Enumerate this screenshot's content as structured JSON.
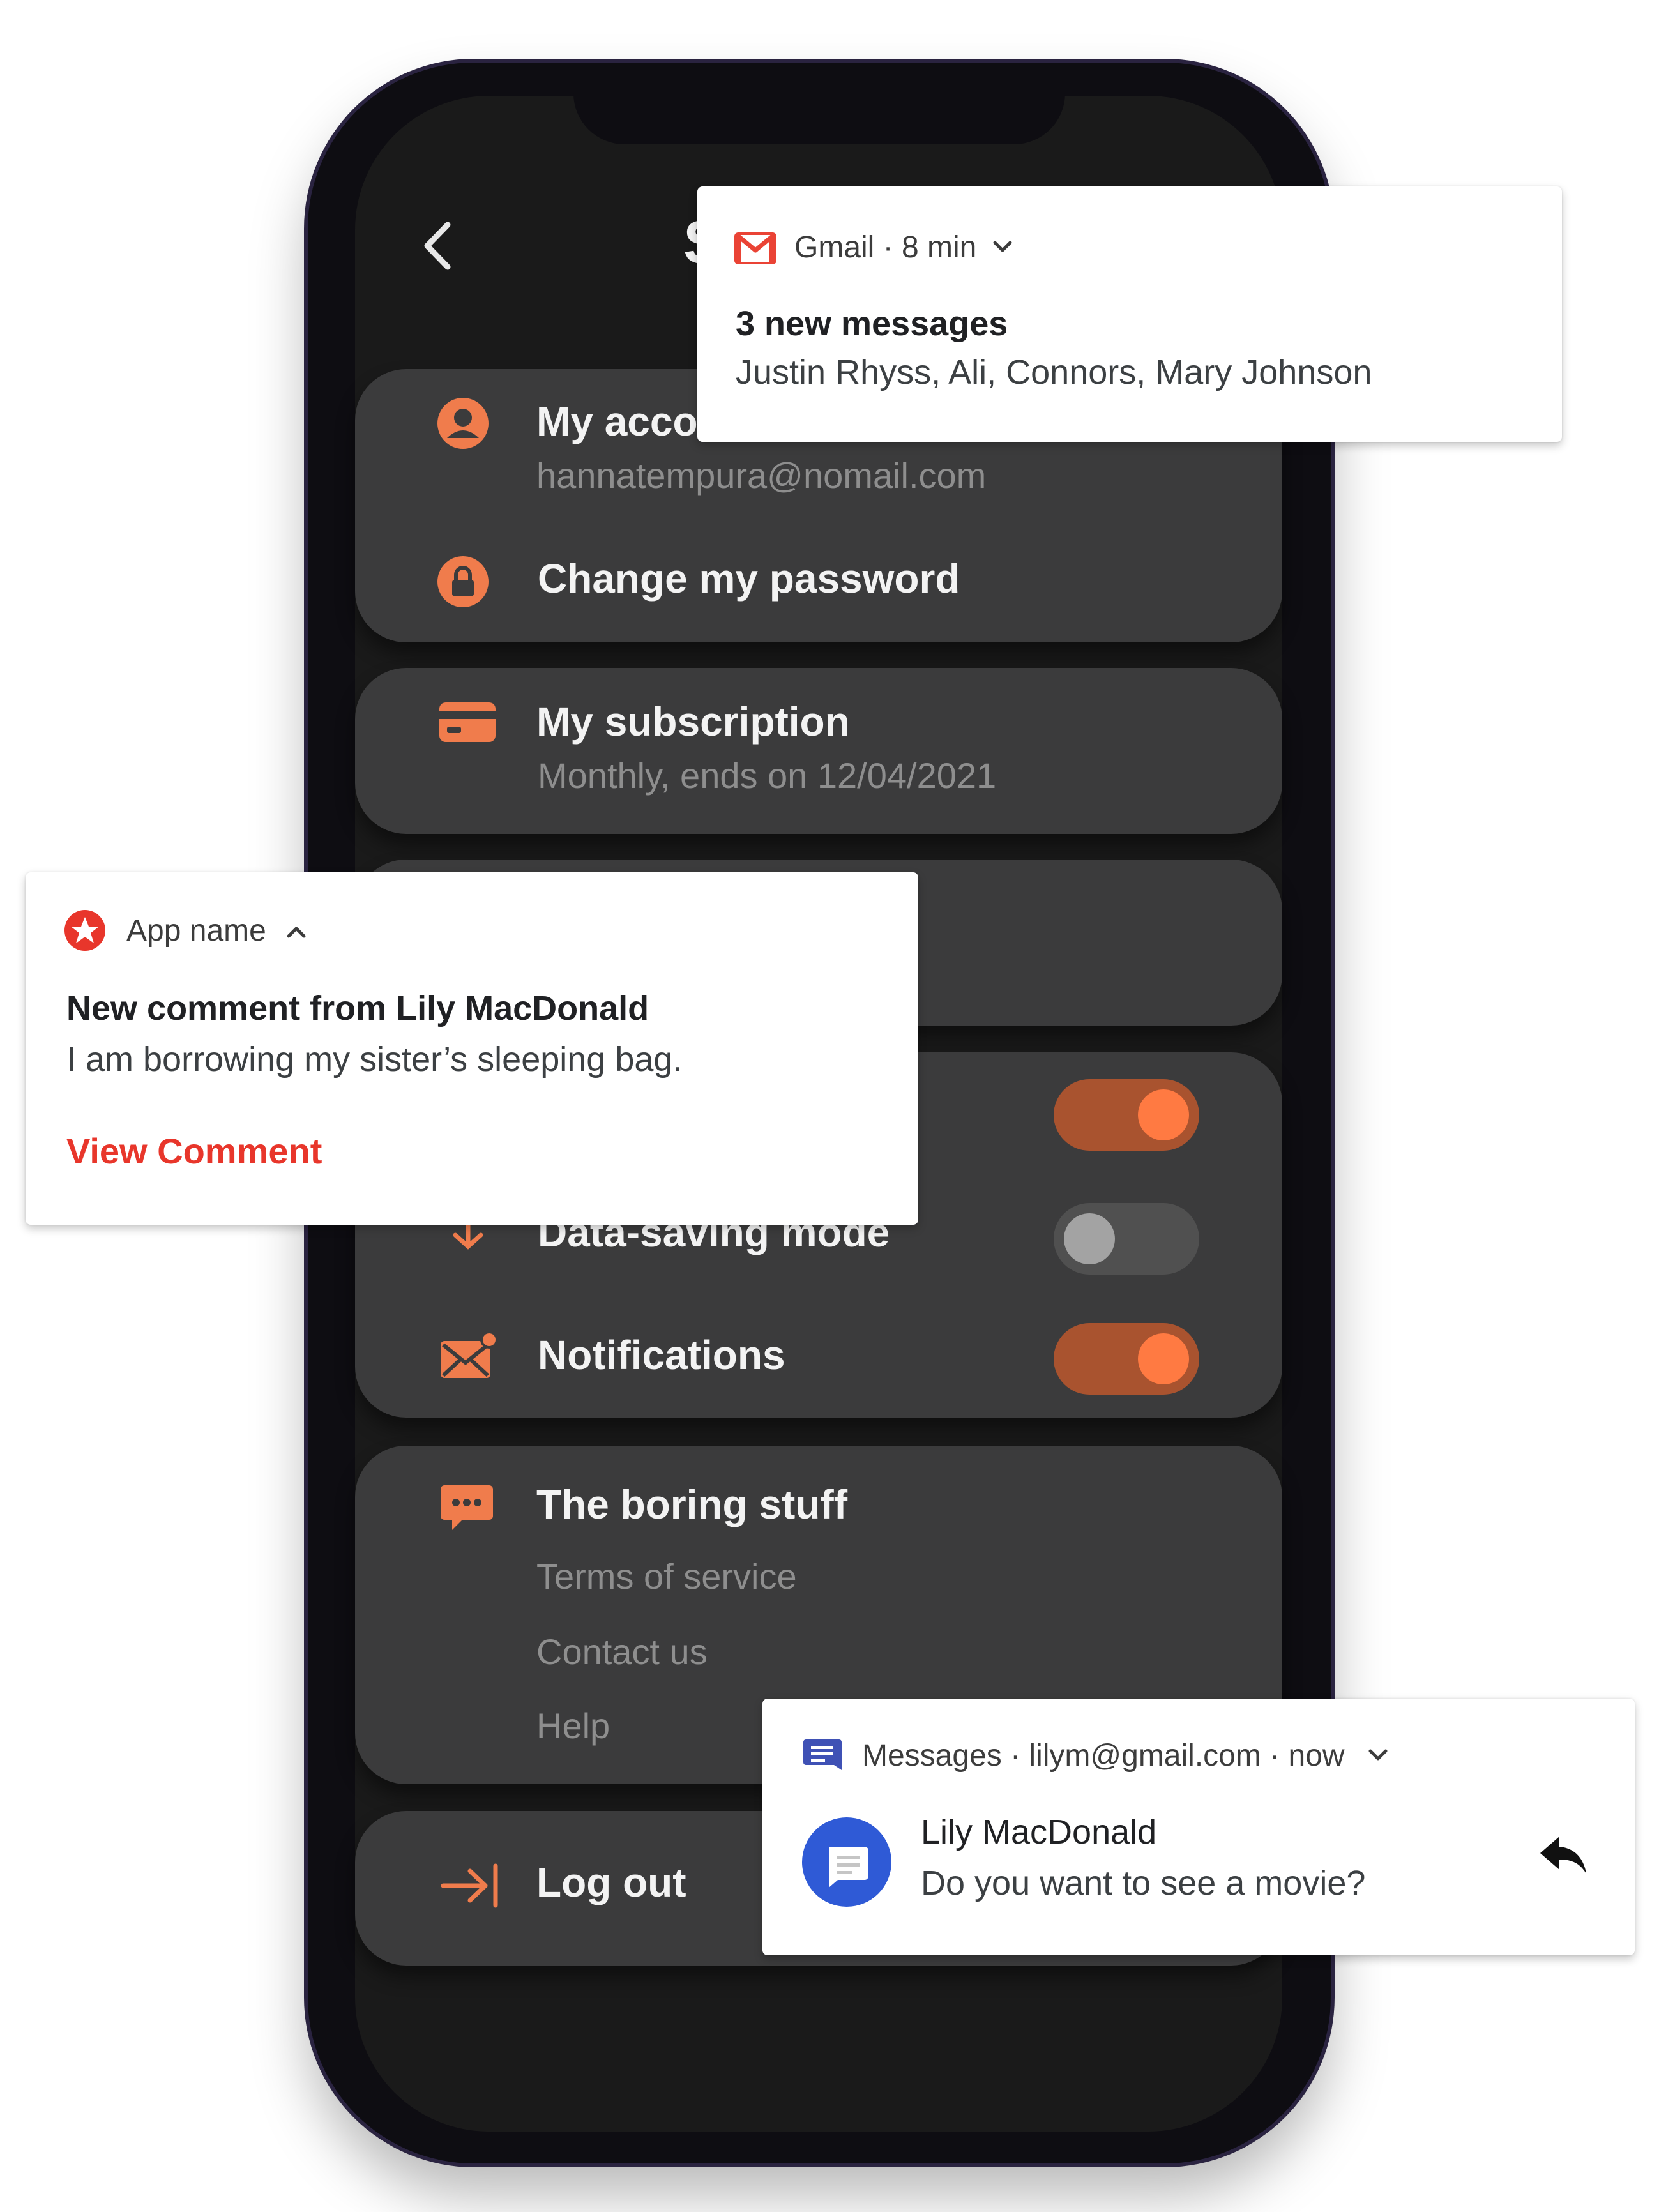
{
  "settings": {
    "title_partial": "S",
    "account": {
      "title": "My account",
      "email": "hannatempura@nomail.com"
    },
    "password": {
      "title": "Change my password"
    },
    "subscription": {
      "title": "My subscription",
      "detail": "Monthly, ends on 12/04/2021"
    },
    "toggles": {
      "row1_on": true,
      "data_saving": {
        "label": "Data-saving mode",
        "on": false
      },
      "notifications": {
        "label": "Notifications",
        "on": true
      }
    },
    "boring": {
      "title": "The boring stuff",
      "links": [
        "Terms of service",
        "Contact us",
        "Help"
      ]
    },
    "logout": {
      "label": "Log out"
    }
  },
  "notifications": {
    "gmail": {
      "meta": "Gmail · 8 min",
      "title": "3 new messages",
      "body": "Justin Rhyss, Ali, Connors, Mary Johnson"
    },
    "app": {
      "meta": "App name",
      "title": "New comment from Lily MacDonald",
      "body": "I am borrowing my sister’s sleeping bag.",
      "action": "View Comment"
    },
    "messages": {
      "meta": "Messages · lilym@gmail.com · now",
      "title": "Lily MacDonald",
      "body": "Do you want to see a movie?"
    }
  },
  "colors": {
    "accent_orange": "#f07c4c",
    "card_bg": "#3b3b3c",
    "gmail_red": "#ea4335",
    "app_red": "#e8362b",
    "messages_blue": "#3f51b5"
  },
  "icons": [
    "back-arrow-icon",
    "user-icon",
    "lock-icon",
    "card-icon",
    "data-saving-icon",
    "mail-notification-icon",
    "chat-bubble-icon",
    "logout-icon",
    "gmail-logo-icon",
    "star-icon",
    "messages-logo-icon",
    "reply-icon",
    "chevron-down-icon",
    "chevron-up-icon"
  ]
}
